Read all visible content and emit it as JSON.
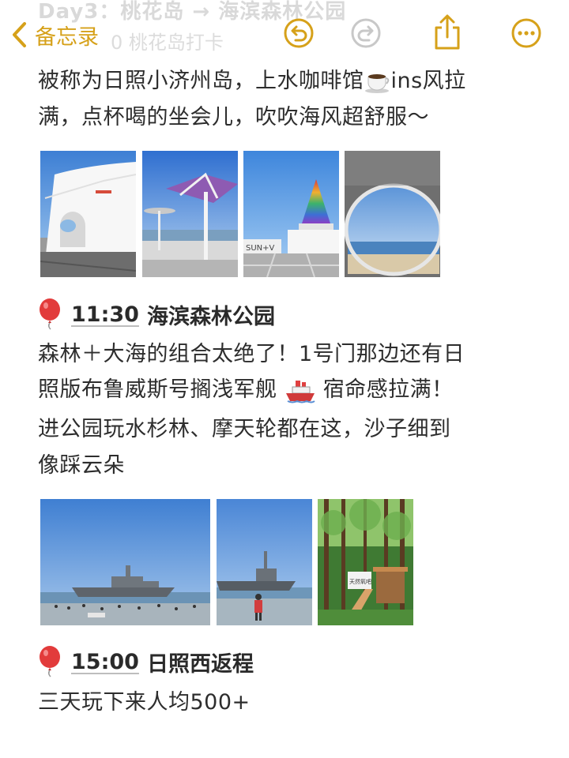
{
  "nav": {
    "back_label": "备忘录",
    "faded_title": "Day3：桃花岛 → 海滨森林公园",
    "faded_sub": "0 桃花岛打卡"
  },
  "section1": {
    "line1a": "被称为日照小济州岛，上水咖啡馆",
    "line1b": "ins风拉",
    "line2": "满，点杯喝的坐会儿，吹吹海风超舒服～"
  },
  "section2": {
    "time": "11:30",
    "title": "海滨森林公园",
    "line1": "森林＋大海的组合太绝了！1号门那边还有日",
    "line2a": "照版布鲁威斯号搁浅军舰",
    "line2b": "宿命感拉满！",
    "line3": "进公园玩水杉林、摩天轮都在这，沙子细到",
    "line4": "像踩云朵"
  },
  "section3": {
    "time": "15:00",
    "title": "日照西返程",
    "line1": "三天玩下来人均500+"
  },
  "photo_text": {
    "sign1": "SUN+V",
    "forest_sign": "天然氧吧"
  },
  "colors": {
    "accent": "#d6a11a",
    "icon_gray": "#c8c8c8"
  }
}
